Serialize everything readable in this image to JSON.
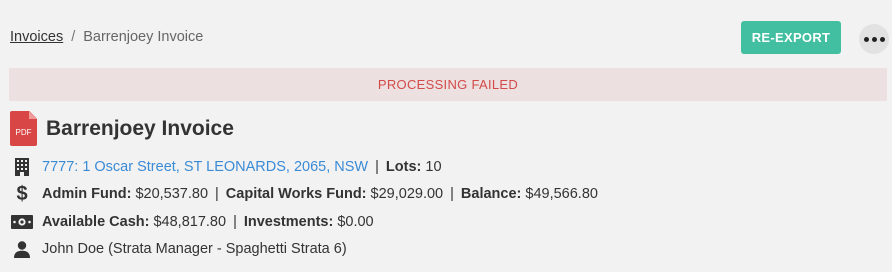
{
  "breadcrumb": {
    "parent": "Invoices",
    "separator": "/",
    "current": "Barrenjoey Invoice"
  },
  "actions": {
    "reexport_label": "RE-EXPORT"
  },
  "alert": {
    "text": "PROCESSING FAILED"
  },
  "document": {
    "file_type": "PDF",
    "title": "Barrenjoey Invoice"
  },
  "property": {
    "address": "7777: 1 Oscar Street, ST LEONARDS, 2065, NSW",
    "lots_label": "Lots:",
    "lots_value": "10"
  },
  "funds": {
    "admin_label": "Admin Fund:",
    "admin_value": "$20,537.80",
    "capital_label": "Capital Works Fund:",
    "capital_value": "$29,029.00",
    "balance_label": "Balance:",
    "balance_value": "$49,566.80"
  },
  "cash": {
    "available_label": "Available Cash:",
    "available_value": "$48,817.80",
    "investments_label": "Investments:",
    "investments_value": "$0.00"
  },
  "manager": {
    "text": "John Doe (Strata Manager - Spaghetti Strata 6)"
  },
  "colors": {
    "accent": "#41bfa0",
    "error_text": "#d34a4a",
    "error_bg": "#ede0e0",
    "link": "#3a8bd6",
    "pdf": "#d94646"
  },
  "icons": [
    "building-icon",
    "dollar-icon",
    "cash-icon",
    "user-icon",
    "pdf-icon",
    "more-options-icon"
  ]
}
